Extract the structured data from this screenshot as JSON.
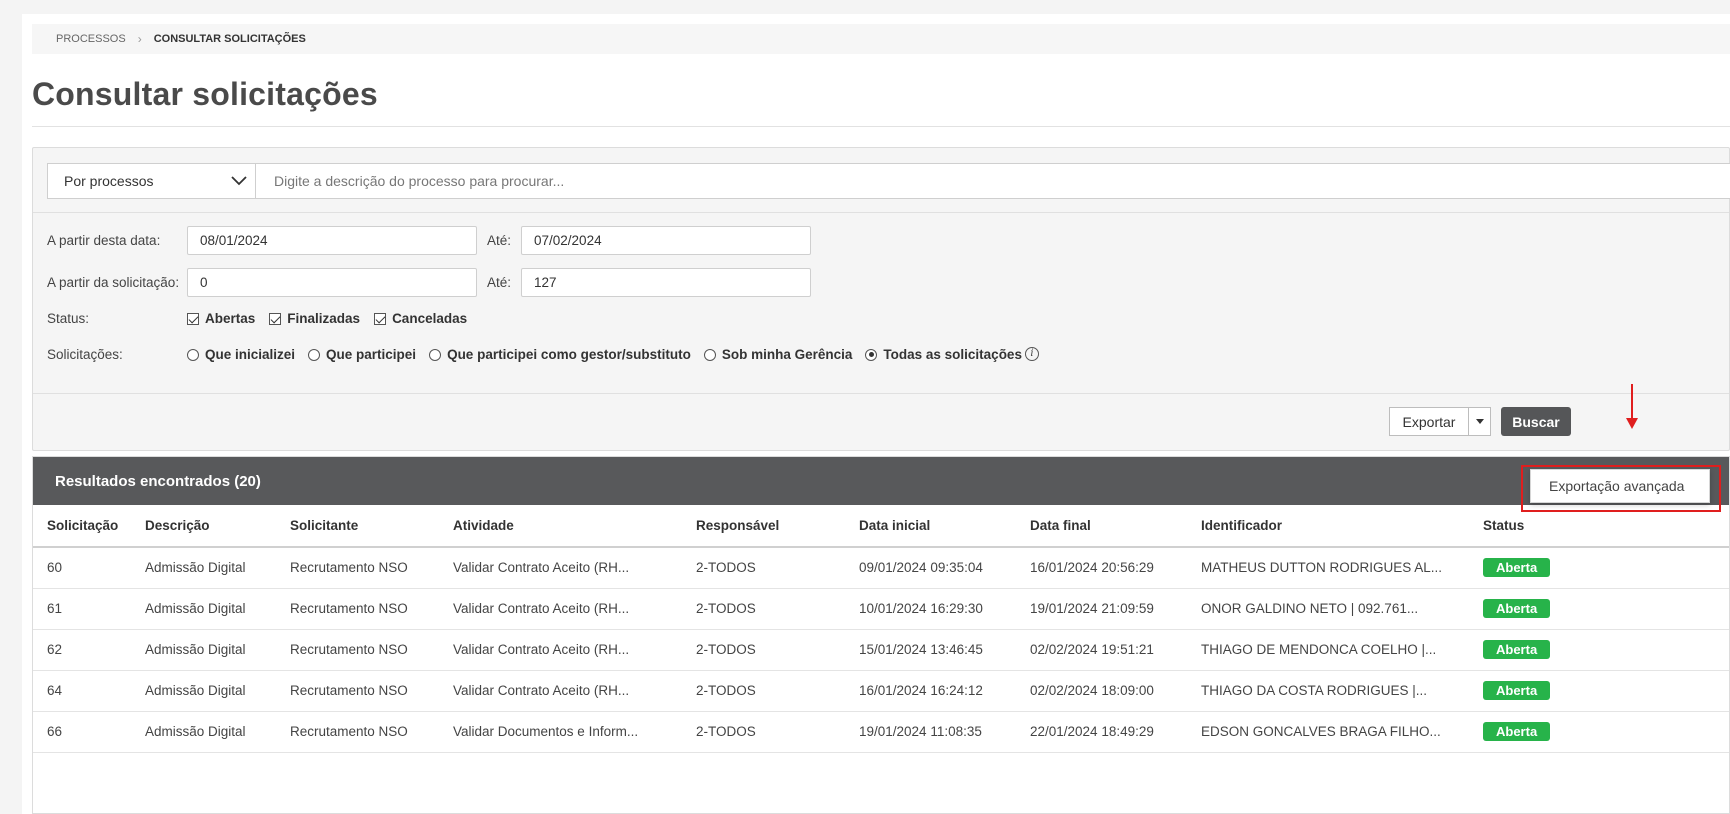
{
  "breadcrumb": {
    "parent": "PROCESSOS",
    "current": "CONSULTAR SOLICITAÇÕES"
  },
  "page_title": "Consultar solicitações",
  "search": {
    "select_value": "Por processos",
    "placeholder": "Digite a descrição do processo para procurar..."
  },
  "filters": {
    "date_from_label": "A partir desta data:",
    "date_from": "08/01/2024",
    "date_to_label": "Até:",
    "date_to": "07/02/2024",
    "req_from_label": "A partir da solicitação:",
    "req_from": "0",
    "req_to_label": "Até:",
    "req_to": "127",
    "status_label": "Status:",
    "status_options": [
      "Abertas",
      "Finalizadas",
      "Canceladas"
    ],
    "requests_label": "Solicitações:",
    "request_options": [
      "Que inicializei",
      "Que participei",
      "Que participei como gestor/substituto",
      "Sob minha Gerência",
      "Todas as solicitações"
    ],
    "selected_request_option": "Todas as solicitações"
  },
  "actions": {
    "export": "Exportar",
    "search": "Buscar",
    "dropdown_item": "Exportação avançada"
  },
  "results": {
    "header": "Resultados encontrados (20)",
    "columns": [
      "Solicitação",
      "Descrição",
      "Solicitante",
      "Atividade",
      "Responsável",
      "Data inicial",
      "Data final",
      "Identificador",
      "Status"
    ],
    "rows": [
      [
        "60",
        "Admissão Digital",
        "Recrutamento NSO",
        "Validar Contrato Aceito (RH...",
        "2-TODOS",
        "09/01/2024 09:35:04",
        "16/01/2024 20:56:29",
        "MATHEUS DUTTON RODRIGUES AL...",
        "Aberta"
      ],
      [
        "61",
        "Admissão Digital",
        "Recrutamento NSO",
        "Validar Contrato Aceito (RH...",
        "2-TODOS",
        "10/01/2024 16:29:30",
        "19/01/2024 21:09:59",
        "ONOR GALDINO NETO | 092.761...",
        "Aberta"
      ],
      [
        "62",
        "Admissão Digital",
        "Recrutamento NSO",
        "Validar Contrato Aceito (RH...",
        "2-TODOS",
        "15/01/2024 13:46:45",
        "02/02/2024 19:51:21",
        "THIAGO DE MENDONCA COELHO |...",
        "Aberta"
      ],
      [
        "64",
        "Admissão Digital",
        "Recrutamento NSO",
        "Validar Contrato Aceito (RH...",
        "2-TODOS",
        "16/01/2024 16:24:12",
        "02/02/2024 18:09:00",
        "THIAGO DA COSTA RODRIGUES |...",
        "Aberta"
      ],
      [
        "66",
        "Admissão Digital",
        "Recrutamento NSO",
        "Validar Documentos e Inform...",
        "2-TODOS",
        "19/01/2024 11:08:35",
        "22/01/2024 18:49:29",
        "EDSON GONCALVES BRAGA FILHO...",
        "Aberta"
      ]
    ]
  },
  "colors": {
    "status_open": "#27b34a",
    "header_bg": "#58595b",
    "highlight": "#e01e1e"
  }
}
